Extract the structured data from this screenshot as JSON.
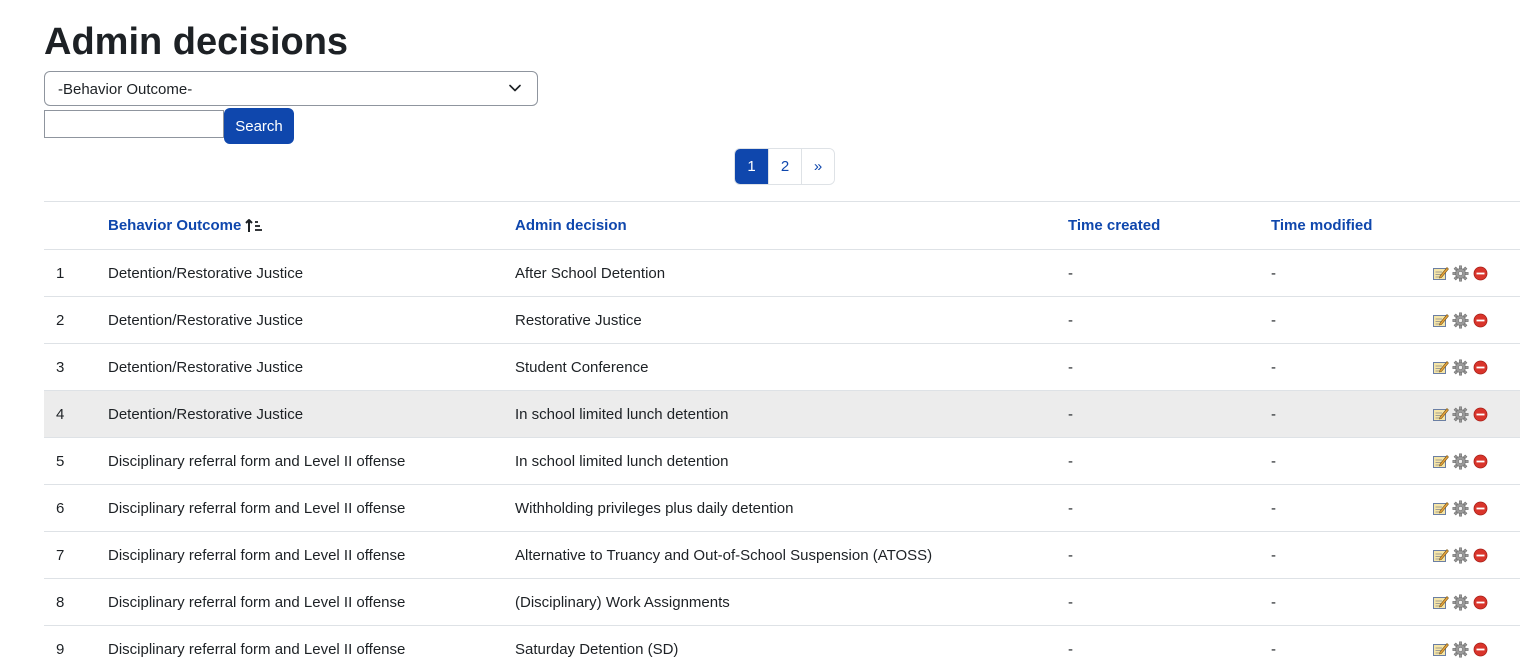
{
  "page": {
    "title": "Admin decisions"
  },
  "filter": {
    "selected": "-Behavior Outcome-",
    "search_value": "",
    "search_button": "Search"
  },
  "pagination": {
    "pages": [
      "1",
      "2"
    ],
    "current": "1",
    "next": "»"
  },
  "table": {
    "headers": {
      "num": "",
      "outcome": "Behavior Outcome",
      "decision": "Admin decision",
      "created": "Time created",
      "modified": "Time modified",
      "actions": ""
    },
    "sort": {
      "column": "Behavior Outcome",
      "icon": "sort-ascending-icon"
    },
    "rows": [
      {
        "num": "1",
        "outcome": "Detention/Restorative Justice",
        "decision": "After School Detention",
        "created": "-",
        "modified": "-"
      },
      {
        "num": "2",
        "outcome": "Detention/Restorative Justice",
        "decision": "Restorative Justice",
        "created": "-",
        "modified": "-"
      },
      {
        "num": "3",
        "outcome": "Detention/Restorative Justice",
        "decision": "Student Conference",
        "created": "-",
        "modified": "-"
      },
      {
        "num": "4",
        "outcome": "Detention/Restorative Justice",
        "decision": "In school limited lunch detention",
        "created": "-",
        "modified": "-"
      },
      {
        "num": "5",
        "outcome": "Disciplinary referral form and Level II offense",
        "decision": "In school limited lunch detention",
        "created": "-",
        "modified": "-"
      },
      {
        "num": "6",
        "outcome": "Disciplinary referral form and Level II offense",
        "decision": "Withholding privileges plus daily detention",
        "created": "-",
        "modified": "-"
      },
      {
        "num": "7",
        "outcome": "Disciplinary referral form and Level II offense",
        "decision": "Alternative to Truancy and Out-of-School Suspension (ATOSS)",
        "created": "-",
        "modified": "-"
      },
      {
        "num": "8",
        "outcome": "Disciplinary referral form and Level II offense",
        "decision": "(Disciplinary) Work Assignments",
        "created": "-",
        "modified": "-"
      },
      {
        "num": "9",
        "outcome": "Disciplinary referral form and Level II offense",
        "decision": "Saturday Detention (SD)",
        "created": "-",
        "modified": "-"
      }
    ],
    "row_actions": [
      "edit-icon",
      "settings-gear-icon",
      "delete-icon"
    ]
  },
  "colors": {
    "primary": "#0f47ad",
    "row_hover": "#ececec",
    "border": "#dee2e6",
    "delete_red": "#d9342b"
  }
}
